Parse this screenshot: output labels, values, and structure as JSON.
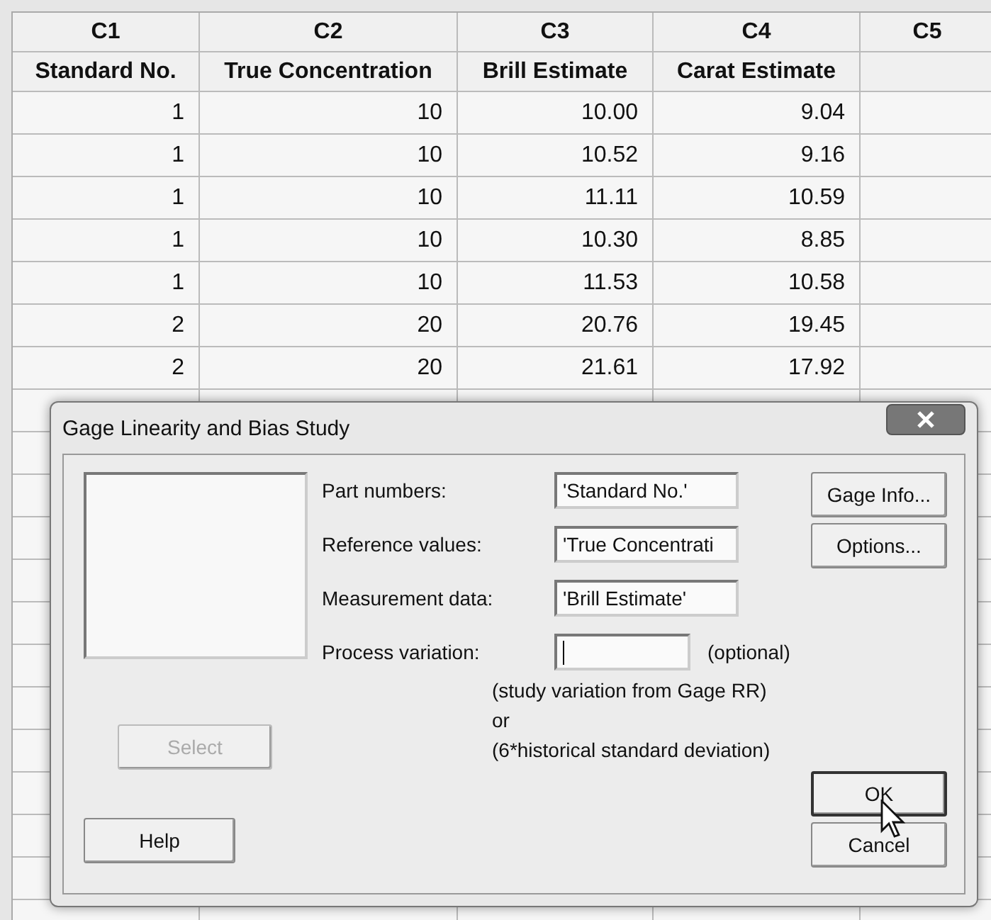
{
  "worksheet": {
    "columns": [
      {
        "id": "C1",
        "name": "Standard No."
      },
      {
        "id": "C2",
        "name": "True Concentration"
      },
      {
        "id": "C3",
        "name": "Brill Estimate"
      },
      {
        "id": "C4",
        "name": "Carat Estimate"
      },
      {
        "id": "C5"
      }
    ],
    "rows": [
      [
        "1",
        "10",
        "10.00",
        "9.04"
      ],
      [
        "1",
        "10",
        "10.52",
        "9.16"
      ],
      [
        "1",
        "10",
        "11.11",
        "10.59"
      ],
      [
        "1",
        "10",
        "10.30",
        "8.85"
      ],
      [
        "1",
        "10",
        "11.53",
        "10.58"
      ],
      [
        "2",
        "20",
        "20.76",
        "19.45"
      ],
      [
        "2",
        "20",
        "21.61",
        "17.92"
      ]
    ]
  },
  "dialog": {
    "title": "Gage Linearity and Bias Study",
    "fields": [
      {
        "label": "Part numbers:",
        "value": "'Standard No.'"
      },
      {
        "label": "Reference values:",
        "value": "'True Concentrati"
      },
      {
        "label": "Measurement data:",
        "value": "'Brill Estimate'"
      },
      {
        "label": "Process variation:",
        "focused": true
      }
    ],
    "optional_note": "(optional)",
    "notes": [
      "(study variation from Gage RR)",
      "or",
      "(6*historical standard deviation)"
    ],
    "select_button": {
      "label": "Select",
      "disabled": true
    },
    "help_button": {
      "label": "Help"
    },
    "side_buttons": [
      {
        "label": "Gage Info..."
      },
      {
        "label": "Options..."
      }
    ],
    "ok_button": {
      "label": "OK",
      "default": true
    },
    "cancel_button": {
      "label": "Cancel"
    }
  }
}
